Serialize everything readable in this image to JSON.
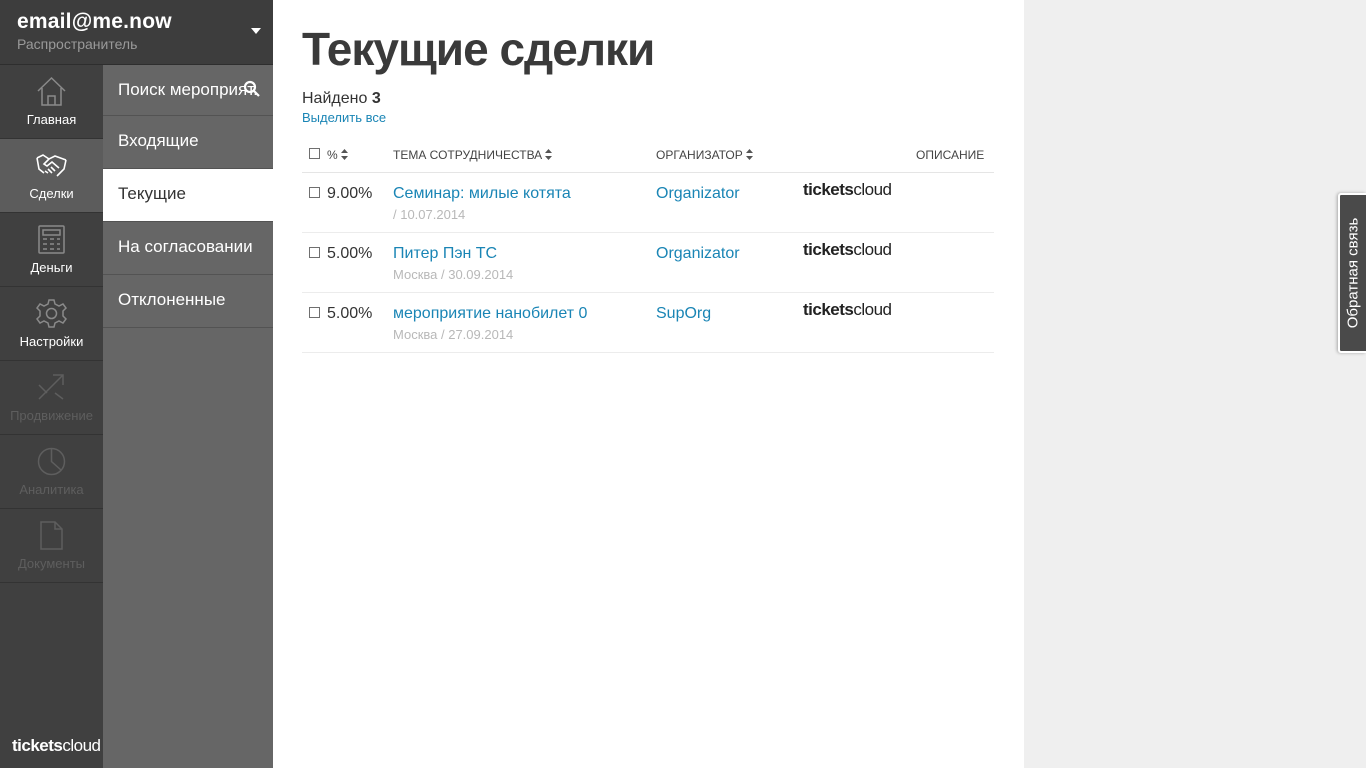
{
  "account": {
    "email": "email@me.now",
    "role": "Распространитель"
  },
  "rail": {
    "items": [
      {
        "label": "Главная",
        "icon": "home-icon",
        "state": "normal"
      },
      {
        "label": "Сделки",
        "icon": "handshake-icon",
        "state": "active"
      },
      {
        "label": "Деньги",
        "icon": "calculator-icon",
        "state": "normal"
      },
      {
        "label": "Настройки",
        "icon": "gear-icon",
        "state": "normal"
      },
      {
        "label": "Продвижение",
        "icon": "arrows-icon",
        "state": "disabled"
      },
      {
        "label": "Аналитика",
        "icon": "pie-chart-icon",
        "state": "disabled"
      },
      {
        "label": "Документы",
        "icon": "document-icon",
        "state": "disabled"
      }
    ],
    "logo": {
      "bold": "tickets",
      "regular": "cloud"
    }
  },
  "subnav": {
    "search_label": "Поиск мероприят.",
    "items": [
      {
        "label": "Входящие",
        "active": false
      },
      {
        "label": "Текущие",
        "active": true
      },
      {
        "label": "На согласовании",
        "active": false
      },
      {
        "label": "Отклоненные",
        "active": false
      }
    ]
  },
  "main": {
    "title": "Текущие сделки",
    "found_label": "Найдено",
    "found_count": "3",
    "select_all": "Выделить все"
  },
  "table": {
    "headers": {
      "percent": "%",
      "topic": "ТЕМА СОТРУДНИЧЕСТВА",
      "organizer": "ОРГАНИЗАТОР",
      "description": "ОПИСАНИЕ"
    },
    "rows": [
      {
        "percent": "9.00%",
        "title": "Семинар: милые котята",
        "sub": "/ 10.07.2014",
        "organizer": "Organizator",
        "logo_bold": "tickets",
        "logo_regular": "cloud"
      },
      {
        "percent": "5.00%",
        "title": "Питер Пэн ТС",
        "sub": "Москва / 30.09.2014",
        "organizer": "Organizator",
        "logo_bold": "tickets",
        "logo_regular": "cloud"
      },
      {
        "percent": "5.00%",
        "title": "мероприятие нанобилет 0",
        "sub": "Москва / 27.09.2014",
        "organizer": "SupOrg",
        "logo_bold": "tickets",
        "logo_regular": "cloud"
      }
    ]
  },
  "feedback": {
    "label": "Обратная связь"
  },
  "colors": {
    "accent": "#1a85b5",
    "rail": "#404040",
    "subnav": "#666666",
    "title": "#3a3a3a"
  }
}
